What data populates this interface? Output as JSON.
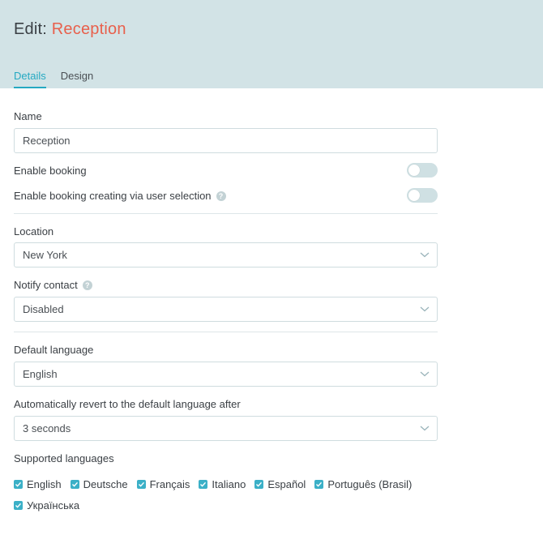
{
  "header": {
    "title_prefix": "Edit: ",
    "title_name": "Reception",
    "accent_color": "#e8604c",
    "tabs": [
      {
        "label": "Details",
        "active": true
      },
      {
        "label": "Design",
        "active": false
      }
    ]
  },
  "form": {
    "name": {
      "label": "Name",
      "value": "Reception"
    },
    "enable_booking": {
      "label": "Enable booking",
      "on": false
    },
    "enable_user_selection": {
      "label": "Enable booking creating via user selection",
      "on": false
    },
    "location": {
      "label": "Location",
      "value": "New York"
    },
    "notify_contact": {
      "label": "Notify contact",
      "value": "Disabled"
    },
    "default_language": {
      "label": "Default language",
      "value": "English"
    },
    "revert": {
      "label": "Automatically revert to the default language after",
      "value": "3 seconds"
    },
    "supported_languages": {
      "label": "Supported languages",
      "items": [
        {
          "label": "English",
          "checked": true
        },
        {
          "label": "Deutsche",
          "checked": true
        },
        {
          "label": "Français",
          "checked": true
        },
        {
          "label": "Italiano",
          "checked": true
        },
        {
          "label": "Español",
          "checked": true
        },
        {
          "label": "Português (Brasil)",
          "checked": true
        },
        {
          "label": "Українська",
          "checked": true
        }
      ]
    }
  },
  "icons": {
    "help": "question-mark-icon",
    "chevron": "chevron-down-icon",
    "check": "checkmark-icon"
  },
  "help_glyph": "?"
}
